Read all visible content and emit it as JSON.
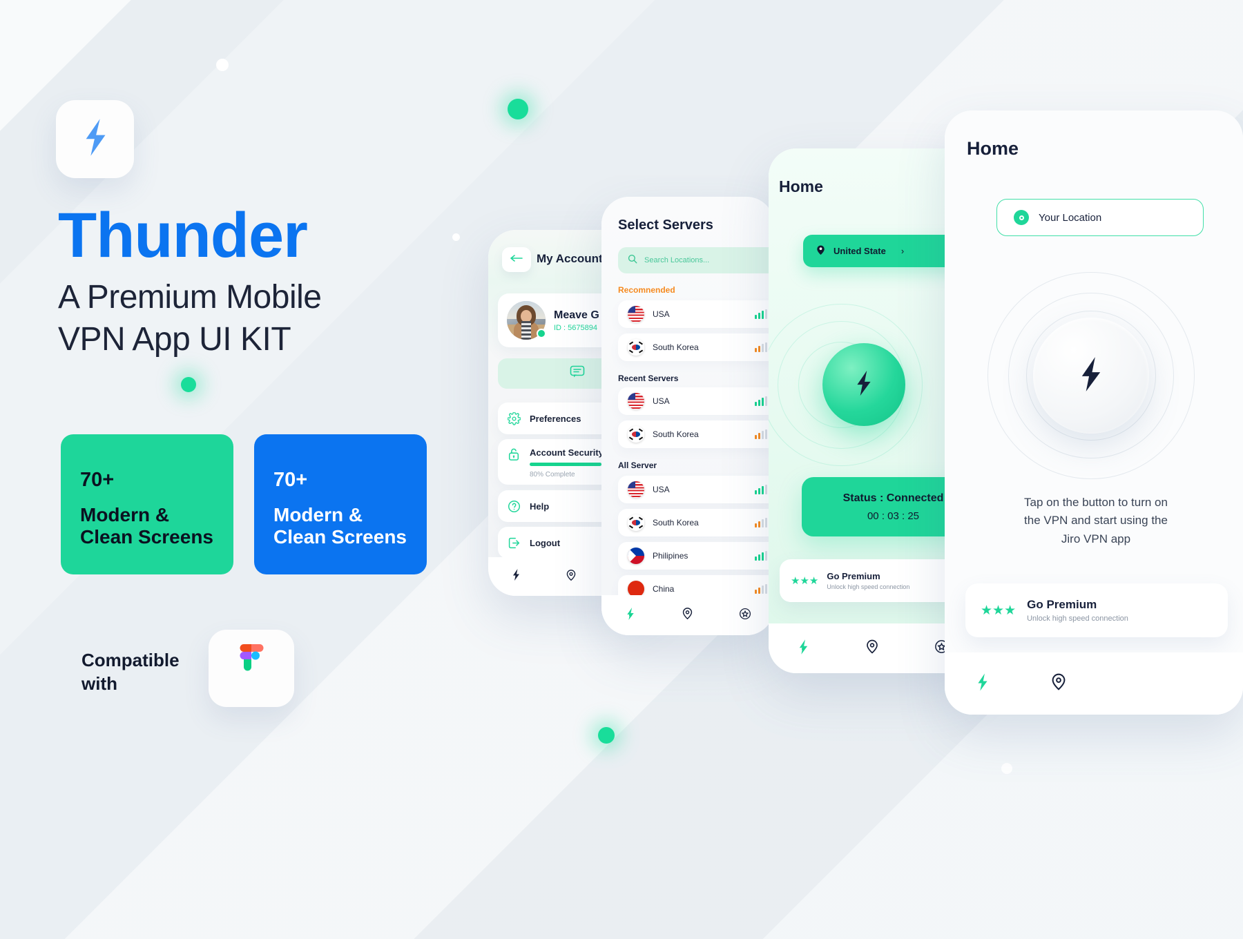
{
  "brand": {
    "logo_icon": "lightning-bolt-icon",
    "title": "Thunder",
    "subtitle": "A Premium Mobile\nVPN App UI KIT",
    "subtitle_line1": "A Premium Mobile",
    "subtitle_line2": "VPN App UI KIT",
    "accent_blue": "#0b74f0",
    "accent_green": "#1ed69a",
    "dark": "#17203a"
  },
  "feature_cards": [
    {
      "count": "70+",
      "text_line1": "Modern &",
      "text_line2": "Clean Screens",
      "bg": "#1ed69a",
      "fg": "#0b1120"
    },
    {
      "count": "70+",
      "text_line1": "Modern &",
      "text_line2": "Clean Screens",
      "bg": "#0b74f0",
      "fg": "#ffffff"
    }
  ],
  "compatibility": {
    "label_line1": "Compatible",
    "label_line2": "with",
    "tool_icon": "figma-logo-icon"
  },
  "account_screen": {
    "back_icon": "arrow-left-icon",
    "title": "My Account",
    "user": {
      "name": "Meave G",
      "id_label": "ID : 5675894",
      "status": "online"
    },
    "chat_icon": "chat-bubble-icon",
    "rows": [
      {
        "icon": "gear-icon",
        "label": "Preferences"
      },
      {
        "icon": "lock-icon",
        "label": "Account Security",
        "progress_percent": 80,
        "progress_label": "80% Complete"
      },
      {
        "icon": "question-circle-icon",
        "label": "Help"
      },
      {
        "icon": "logout-icon",
        "label": "Logout"
      }
    ],
    "tabs": [
      {
        "icon": "bolt-icon",
        "active": true
      },
      {
        "icon": "location-pin-icon",
        "active": false
      },
      {
        "icon": "star-circle-icon",
        "active": false
      }
    ]
  },
  "servers_screen": {
    "title": "Select Servers",
    "search": {
      "icon": "search-icon",
      "placeholder": "Search Locations...",
      "value": ""
    },
    "sections": [
      {
        "label": "Recomnended",
        "color": "#f58a1f",
        "items": [
          {
            "flag": "us-flag-icon",
            "name": "USA",
            "signal": 4,
            "signal_color": "#16d48e"
          },
          {
            "flag": "kr-flag-icon",
            "name": "South Korea",
            "signal": 2,
            "signal_color": "#f58a1f"
          }
        ]
      },
      {
        "label": "Recent Servers",
        "color": "#17203a",
        "items": [
          {
            "flag": "us-flag-icon",
            "name": "USA",
            "signal": 4,
            "signal_color": "#16d48e"
          },
          {
            "flag": "kr-flag-icon",
            "name": "South Korea",
            "signal": 2,
            "signal_color": "#f58a1f"
          }
        ]
      },
      {
        "label": "All Server",
        "color": "#17203a",
        "items": [
          {
            "flag": "us-flag-icon",
            "name": "USA",
            "signal": 4,
            "signal_color": "#16d48e"
          },
          {
            "flag": "kr-flag-icon",
            "name": "South Korea",
            "signal": 2,
            "signal_color": "#f58a1f"
          },
          {
            "flag": "ph-flag-icon",
            "name": "Philipines",
            "signal": 4,
            "signal_color": "#16d48e"
          },
          {
            "flag": "cn-flag-icon",
            "name": "China",
            "signal": 2,
            "signal_color": "#f58a1f"
          }
        ]
      }
    ],
    "tabs": [
      {
        "icon": "bolt-icon",
        "active": true
      },
      {
        "icon": "location-pin-icon",
        "active": false
      },
      {
        "icon": "star-circle-icon",
        "active": false
      }
    ]
  },
  "home_connected": {
    "title": "Home",
    "location": {
      "icon": "location-pin-icon",
      "label": "United State",
      "chevron": "›"
    },
    "power_icon": "bolt-icon",
    "status": {
      "label": "Status :  Connected",
      "timer": "00 : 03 : 25"
    },
    "premium": {
      "stars": "★★★",
      "title": "Go Premium",
      "subtitle": "Unlock high speed connection"
    },
    "tabs": [
      {
        "icon": "bolt-icon",
        "active": true
      },
      {
        "icon": "location-pin-icon",
        "active": false
      },
      {
        "icon": "star-circle-icon",
        "active": false
      }
    ]
  },
  "home_disconnected": {
    "title": "Home",
    "location": {
      "icon": "location-pin-icon",
      "label": "Your Location"
    },
    "power_icon": "bolt-icon",
    "hint_line1": "Tap on the button to turn on",
    "hint_line2": "the VPN and start using the",
    "hint_line3": "Jiro VPN app",
    "premium": {
      "stars": "★★★",
      "title": "Go Premium",
      "subtitle": "Unlock high speed connection"
    },
    "tabs": [
      {
        "icon": "bolt-icon",
        "active": true
      },
      {
        "icon": "location-pin-icon",
        "active": false
      }
    ]
  }
}
